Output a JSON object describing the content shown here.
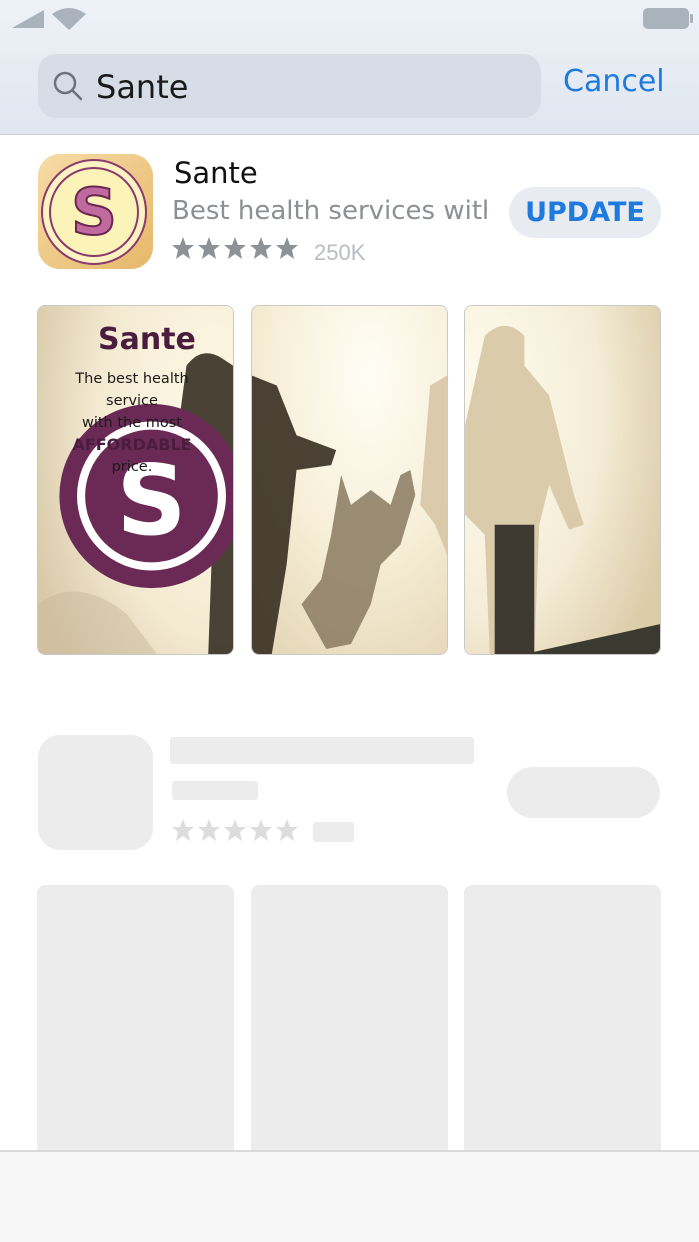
{
  "search": {
    "query": "Sante",
    "cancel_label": "Cancel"
  },
  "app": {
    "name": "Sante",
    "subtitle": "Best health services with...",
    "rating_stars": 5,
    "rating_count": "250K",
    "update_label": "UPDATE",
    "icon_letter": "S"
  },
  "screenshots": {
    "promo_logo_letter": "S",
    "promo_brand": "Sante",
    "promo_line1": "The best health service",
    "promo_line2": "with the most",
    "promo_line3": "AFFORDABLE",
    "promo_line4": "price."
  },
  "colors": {
    "accent": "#1f7ae0",
    "brand": "#4a1d3f",
    "icon_bg": "#f0cc85",
    "icon_badge": "#c06aa0",
    "skeleton": "#ececec"
  }
}
